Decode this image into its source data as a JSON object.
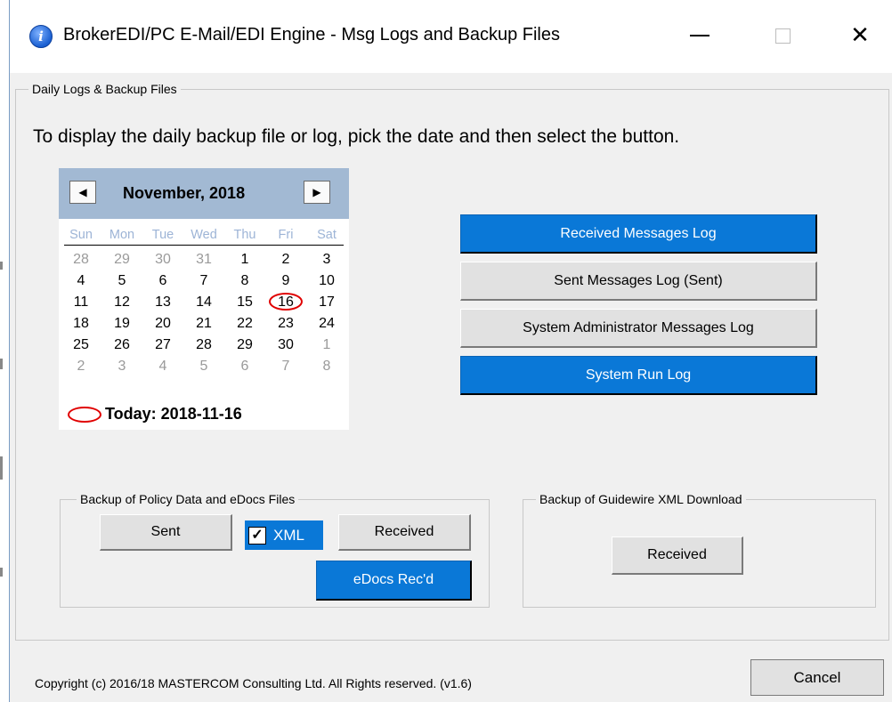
{
  "window": {
    "title": "BrokerEDI/PC E-Mail/EDI Engine - Msg Logs and Backup Files",
    "icon": "info-icon",
    "minimize_glyph": "—",
    "close_glyph": "✕"
  },
  "main_group": {
    "legend": "Daily Logs & Backup Files",
    "instruction": "To display the daily backup file or log, pick the date and then select the button."
  },
  "calendar": {
    "month_label": "November, 2018",
    "prev_glyph": "◀",
    "next_glyph": "▶",
    "day_headers": [
      "Sun",
      "Mon",
      "Tue",
      "Wed",
      "Thu",
      "Fri",
      "Sat"
    ],
    "weeks": [
      [
        "28",
        "29",
        "30",
        "31",
        "1",
        "2",
        "3"
      ],
      [
        "4",
        "5",
        "6",
        "7",
        "8",
        "9",
        "10"
      ],
      [
        "11",
        "12",
        "13",
        "14",
        "15",
        "16",
        "17"
      ],
      [
        "18",
        "19",
        "20",
        "21",
        "22",
        "23",
        "24"
      ],
      [
        "25",
        "26",
        "27",
        "28",
        "29",
        "30",
        "1"
      ],
      [
        "2",
        "3",
        "4",
        "5",
        "6",
        "7",
        "8"
      ]
    ],
    "today_label": "Today: 2018-11-16",
    "header_color": "#a2b9d3",
    "today_marker_color": "#e00000"
  },
  "log_buttons": {
    "received": "Received Messages Log",
    "sent": "Sent Messages Log (Sent)",
    "sysadmin": "System Administrator Messages Log",
    "run": "System Run Log"
  },
  "policy_backup": {
    "legend": "Backup of Policy Data and eDocs Files",
    "sent": "Sent",
    "xml_label": "XML",
    "xml_checked": true,
    "received": "Received",
    "edocs": "eDocs Rec'd"
  },
  "guidewire_backup": {
    "legend": "Backup of Guidewire XML Download",
    "received": "Received"
  },
  "footer": {
    "copyright": "Copyright (c) 2016/18 MASTERCOM Consulting Ltd. All Rights reserved.  (v1.6)",
    "cancel": "Cancel"
  },
  "colors": {
    "accent_blue": "#0a78d7",
    "window_bg": "#f0f0f0"
  }
}
